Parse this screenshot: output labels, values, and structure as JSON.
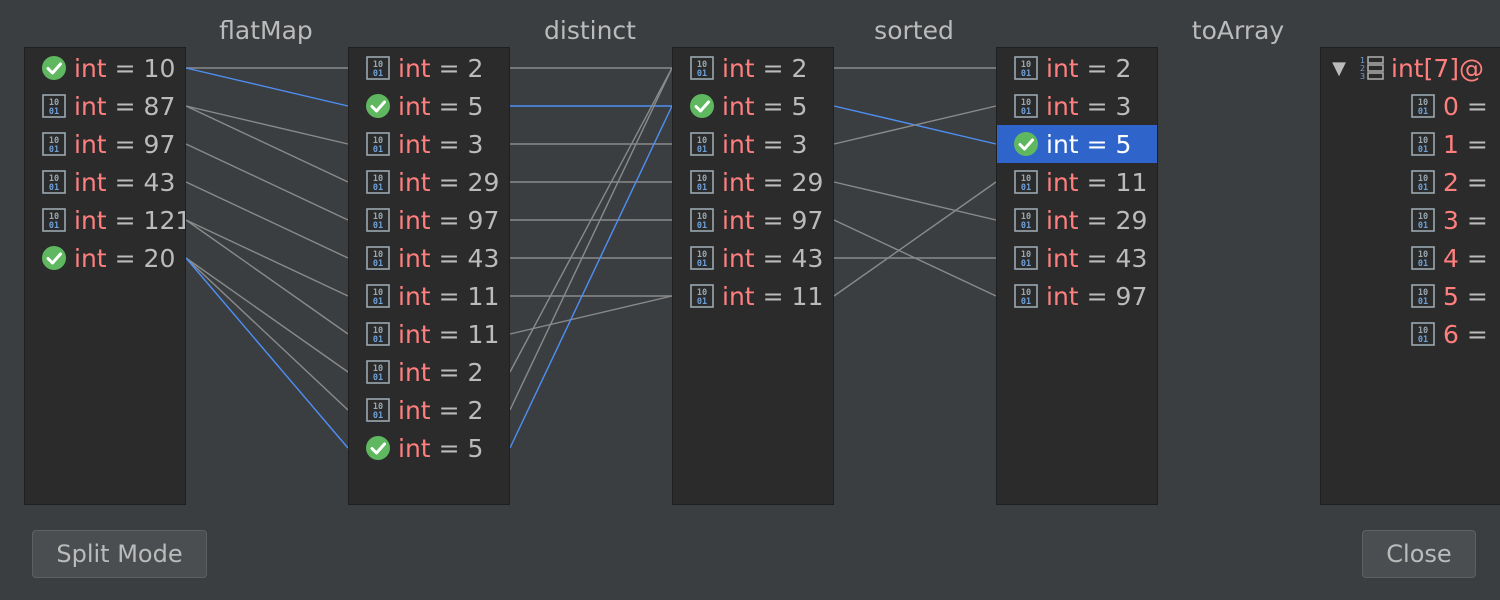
{
  "operations": [
    "flatMap",
    "distinct",
    "sorted",
    "toArray"
  ],
  "columns": [
    {
      "id": "source",
      "rows": [
        {
          "type": "int",
          "value": "10",
          "matched": true
        },
        {
          "type": "int",
          "value": "87",
          "matched": false
        },
        {
          "type": "int",
          "value": "97",
          "matched": false
        },
        {
          "type": "int",
          "value": "43",
          "matched": false
        },
        {
          "type": "int",
          "value": "121",
          "matched": false
        },
        {
          "type": "int",
          "value": "20",
          "matched": true
        }
      ]
    },
    {
      "id": "after-flatMap",
      "rows": [
        {
          "type": "int",
          "value": "2",
          "matched": false
        },
        {
          "type": "int",
          "value": "5",
          "matched": true
        },
        {
          "type": "int",
          "value": "3",
          "matched": false
        },
        {
          "type": "int",
          "value": "29",
          "matched": false
        },
        {
          "type": "int",
          "value": "97",
          "matched": false
        },
        {
          "type": "int",
          "value": "43",
          "matched": false
        },
        {
          "type": "int",
          "value": "11",
          "matched": false
        },
        {
          "type": "int",
          "value": "11",
          "matched": false
        },
        {
          "type": "int",
          "value": "2",
          "matched": false
        },
        {
          "type": "int",
          "value": "2",
          "matched": false
        },
        {
          "type": "int",
          "value": "5",
          "matched": true
        }
      ]
    },
    {
      "id": "after-distinct",
      "rows": [
        {
          "type": "int",
          "value": "2",
          "matched": false
        },
        {
          "type": "int",
          "value": "5",
          "matched": true
        },
        {
          "type": "int",
          "value": "3",
          "matched": false
        },
        {
          "type": "int",
          "value": "29",
          "matched": false
        },
        {
          "type": "int",
          "value": "97",
          "matched": false
        },
        {
          "type": "int",
          "value": "43",
          "matched": false
        },
        {
          "type": "int",
          "value": "11",
          "matched": false
        }
      ]
    },
    {
      "id": "after-sorted",
      "rows": [
        {
          "type": "int",
          "value": "2",
          "matched": false
        },
        {
          "type": "int",
          "value": "3",
          "matched": false
        },
        {
          "type": "int",
          "value": "5",
          "matched": true,
          "selected": true
        },
        {
          "type": "int",
          "value": "11",
          "matched": false
        },
        {
          "type": "int",
          "value": "29",
          "matched": false
        },
        {
          "type": "int",
          "value": "43",
          "matched": false
        },
        {
          "type": "int",
          "value": "97",
          "matched": false
        }
      ]
    }
  ],
  "result": {
    "label": "int[7]@",
    "items": [
      {
        "index": "0",
        "sep": "="
      },
      {
        "index": "1",
        "sep": "="
      },
      {
        "index": "2",
        "sep": "="
      },
      {
        "index": "3",
        "sep": "="
      },
      {
        "index": "4",
        "sep": "="
      },
      {
        "index": "5",
        "sep": "="
      },
      {
        "index": "6",
        "sep": "="
      }
    ]
  },
  "links": [
    [
      {
        "from": 0,
        "to": [
          0,
          1
        ],
        "active": [
          false,
          true
        ]
      },
      {
        "from": 1,
        "to": [
          2,
          3
        ],
        "active": [
          false,
          false
        ]
      },
      {
        "from": 2,
        "to": [
          4
        ],
        "active": [
          false
        ]
      },
      {
        "from": 3,
        "to": [
          5
        ],
        "active": [
          false
        ]
      },
      {
        "from": 4,
        "to": [
          6,
          7
        ],
        "active": [
          false,
          false
        ]
      },
      {
        "from": 5,
        "to": [
          8,
          9,
          10
        ],
        "active": [
          false,
          false,
          true
        ]
      }
    ],
    [
      {
        "from": 0,
        "to": 0,
        "active": false
      },
      {
        "from": 1,
        "to": 1,
        "active": true
      },
      {
        "from": 2,
        "to": 2,
        "active": false
      },
      {
        "from": 3,
        "to": 3,
        "active": false
      },
      {
        "from": 4,
        "to": 4,
        "active": false
      },
      {
        "from": 5,
        "to": 5,
        "active": false
      },
      {
        "from": 6,
        "to": 6,
        "active": false
      },
      {
        "from": 7,
        "to": 6,
        "active": false
      },
      {
        "from": 8,
        "to": 0,
        "active": false
      },
      {
        "from": 9,
        "to": 0,
        "active": false
      },
      {
        "from": 10,
        "to": 1,
        "active": true
      }
    ],
    [
      {
        "from": 0,
        "to": 0,
        "active": false
      },
      {
        "from": 1,
        "to": 2,
        "active": true
      },
      {
        "from": 2,
        "to": 1,
        "active": false
      },
      {
        "from": 3,
        "to": 4,
        "active": false
      },
      {
        "from": 4,
        "to": 6,
        "active": false
      },
      {
        "from": 5,
        "to": 5,
        "active": false
      },
      {
        "from": 6,
        "to": 3,
        "active": false
      }
    ]
  ],
  "buttons": {
    "split_mode": "Split Mode",
    "close": "Close"
  },
  "colors": {
    "keyword": "#ff7f7f",
    "link": "#8a8a8a",
    "link_active": "#4e8ff5",
    "selected_row": "#2f65ca",
    "check": "#5fb760"
  },
  "icons": {
    "value": "binary-value-icon",
    "matched": "check-circle-icon",
    "array": "array-icon",
    "expand": "expand-arrow-icon"
  }
}
